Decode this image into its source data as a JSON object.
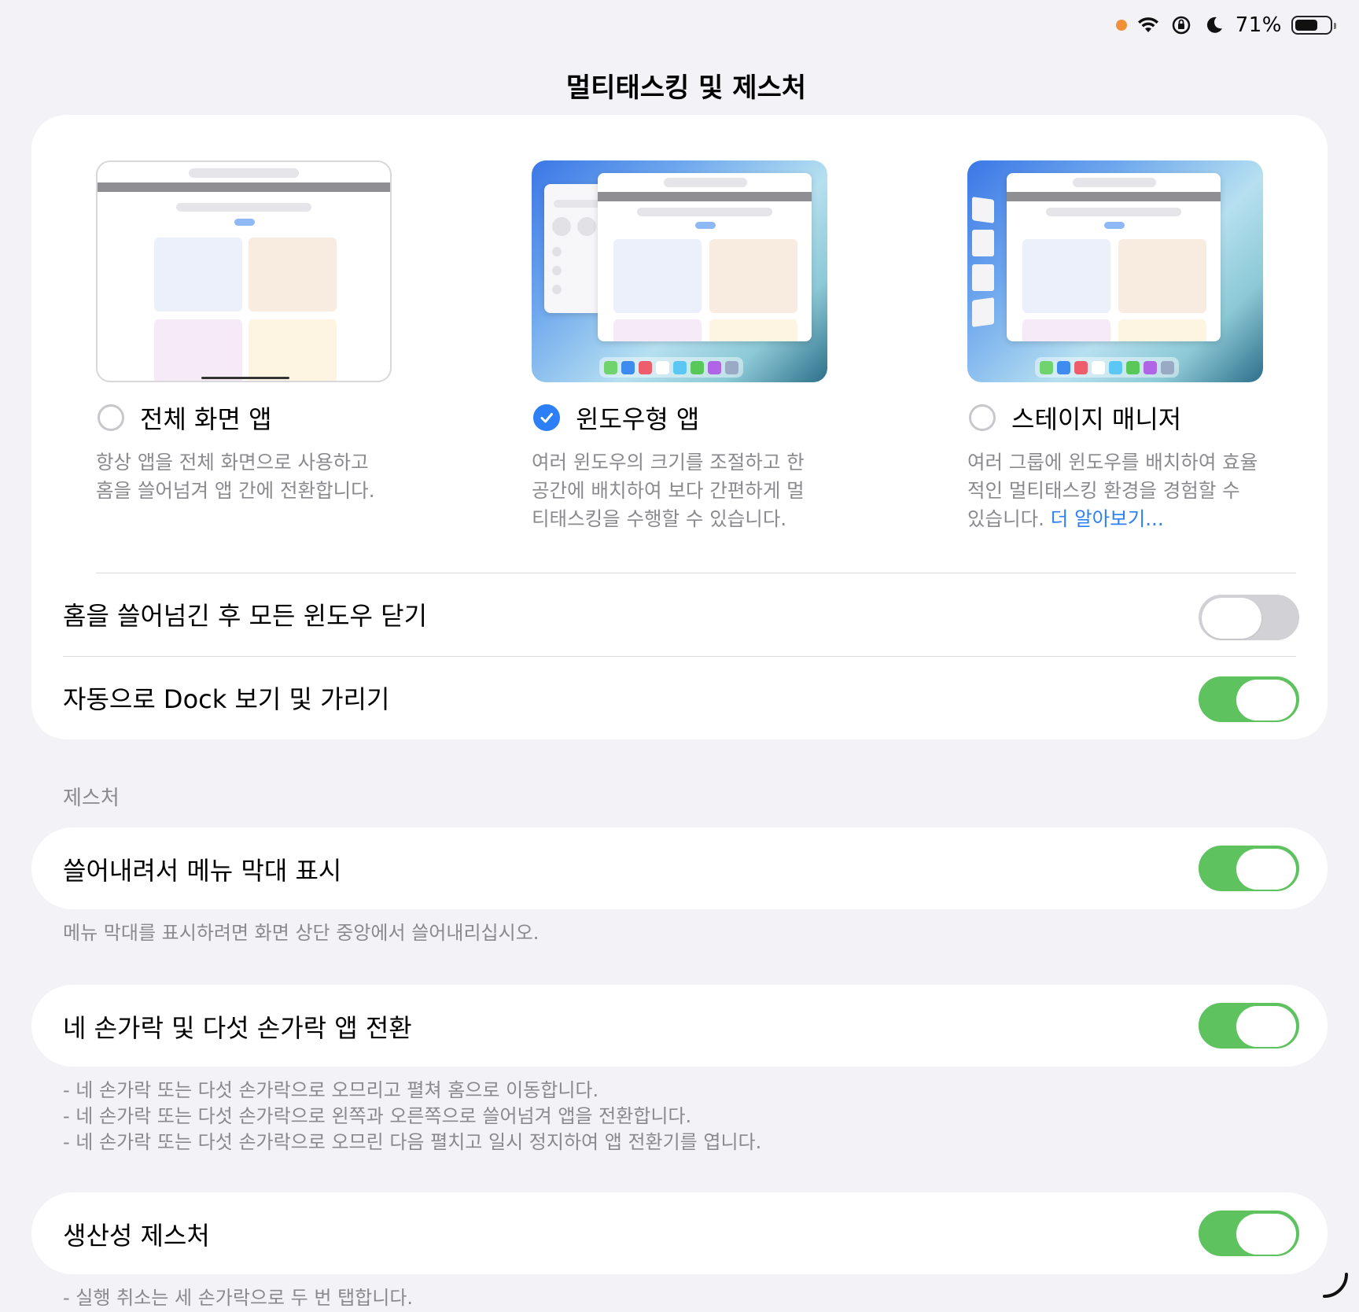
{
  "status_bar": {
    "battery_percent": "71%",
    "battery_level": 0.71
  },
  "page": {
    "title": "멀티태스킹 및 제스처"
  },
  "modes": [
    {
      "label": "전체 화면 앱",
      "selected": false,
      "description": "항상 앱을 전체 화면으로 사용하고 홈을 쓸어넘겨 앱 간에 전환합니다."
    },
    {
      "label": "윈도우형 앱",
      "selected": true,
      "description": "여러 윈도우의 크기를 조절하고 한 공간에 배치하여 보다 간편하게 멀티태스킹을 수행할 수 있습니다."
    },
    {
      "label": "스테이지 매니저",
      "selected": false,
      "description": "여러 그룹에 윈도우를 배치하여 효율적인 멀티태스킹 환경을 경험할 수 있습니다.",
      "link": "더 알아보기..."
    }
  ],
  "settings": {
    "close_windows": {
      "label": "홈을 쓸어넘긴 후 모든 윈도우 닫기",
      "on": false
    },
    "auto_dock": {
      "label": "자동으로 Dock 보기 및 가리기",
      "on": true
    }
  },
  "gestures": {
    "header": "제스처",
    "menu_bar": {
      "label": "쓸어내려서 메뉴 막대 표시",
      "on": true,
      "footnote": "메뉴 막대를 표시하려면 화면 상단 중앙에서 쓸어내리십시오."
    },
    "multi_finger": {
      "label": "네 손가락 및 다섯 손가락 앱 전환",
      "on": true,
      "footnotes": [
        "- 네 손가락 또는 다섯 손가락으로 오므리고 펼쳐 홈으로 이동합니다.",
        "- 네 손가락 또는 다섯 손가락으로 왼쪽과 오른쪽으로 쓸어넘겨 앱을 전환합니다.",
        "- 네 손가락 또는 다섯 손가락으로 오므린 다음 펼치고 일시 정지하여 앱 전환기를 엽니다."
      ]
    },
    "productivity": {
      "label": "생산성 제스처",
      "on": true,
      "footnote": "- 실행 취소는 세 손가락으로 두 번 탭합니다."
    }
  },
  "colors": {
    "accent": "#2c7ff6",
    "toggle_on": "#5ec25f",
    "toggle_off": "#d1d1d6",
    "background": "#f2f2f7"
  },
  "dock_colors": [
    "#6fd46d",
    "#3f8cf0",
    "#ee5d6c",
    "#ffffff",
    "#5cc7f5",
    "#58c958",
    "#b065e6",
    "#9aa9c4"
  ]
}
